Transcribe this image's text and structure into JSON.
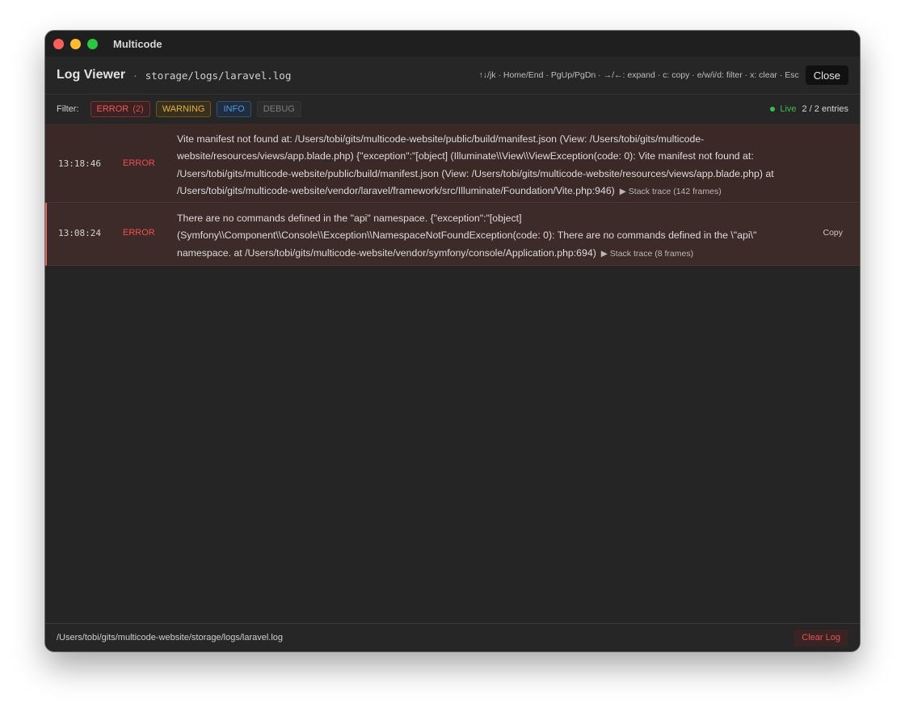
{
  "window": {
    "app_title": "Multicode"
  },
  "header": {
    "title": "Log Viewer",
    "separator": "·",
    "path": "storage/logs/laravel.log",
    "shortcuts": "↑↓/jk · Home/End · PgUp/PgDn · →/←: expand · c: copy · e/w/i/d: filter · x: clear · Esc",
    "close_label": "Close"
  },
  "filters": {
    "label": "Filter:",
    "error": {
      "label": "ERROR",
      "count": "(2)"
    },
    "warning": {
      "label": "WARNING"
    },
    "info": {
      "label": "INFO"
    },
    "debug": {
      "label": "DEBUG"
    },
    "live_label": "Live",
    "entries": "2 / 2 entries"
  },
  "logs": [
    {
      "time": "13:18:46",
      "level": "ERROR",
      "message": "Vite manifest not found at: /Users/tobi/gits/multicode-website/public/build/manifest.json (View: /Users/tobi/gits/multicode-website/resources/views/app.blade.php) {\"exception\":\"[object] (Illuminate\\\\View\\\\ViewException(code: 0): Vite manifest not found at: /Users/tobi/gits/multicode-website/public/build/manifest.json (View: /Users/tobi/gits/multicode-website/resources/views/app.blade.php) at /Users/tobi/gits/multicode-website/vendor/laravel/framework/src/Illuminate/Foundation/Vite.php:946)",
      "trace": "▶ Stack trace (142 frames)"
    },
    {
      "time": "13:08:24",
      "level": "ERROR",
      "message": "There are no commands defined in the \"api\" namespace. {\"exception\":\"[object] (Symfony\\\\Component\\\\Console\\\\Exception\\\\NamespaceNotFoundException(code: 0): There are no commands defined in the \\\"api\\\" namespace. at /Users/tobi/gits/multicode-website/vendor/symfony/console/Application.php:694)",
      "trace": "▶ Stack trace (8 frames)",
      "copy_label": "Copy"
    }
  ],
  "footer": {
    "path": "/Users/tobi/gits/multicode-website/storage/logs/laravel.log",
    "clear_label": "Clear Log"
  },
  "colors": {
    "error": "#ef5050",
    "warning": "#e6b23a",
    "info": "#4d9ae6",
    "live": "#3fb950"
  }
}
